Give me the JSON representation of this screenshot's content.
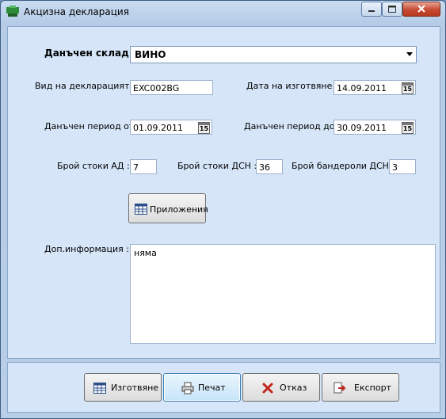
{
  "window": {
    "title": "Акцизна декларация"
  },
  "warehouse": {
    "label": "Данъчен склад :",
    "value": "ВИНО"
  },
  "declaration_type": {
    "label": "Вид на декларацията :",
    "value": "EXC002BG"
  },
  "date_created": {
    "label": "Дата на изготвяне :",
    "value": "14.09.2011"
  },
  "period_from": {
    "label": "Данъчен период от :",
    "value": "01.09.2011"
  },
  "period_to": {
    "label": "Данъчен период до :",
    "value": "30.09.2011"
  },
  "goods_ad": {
    "label": "Брой стоки АД :",
    "value": "7"
  },
  "goods_dsn": {
    "label": "Брой стоки ДСН :",
    "value": "36"
  },
  "banderols_dsn": {
    "label": "Брой бандероли ДСН :",
    "value": "3"
  },
  "attachments_button": {
    "label": "Приложения"
  },
  "additional_info": {
    "label": "Доп.информация :",
    "value": "няма"
  },
  "calendar_icon_text": "15",
  "buttons": {
    "generate": "Изготвяне",
    "print": "Печат",
    "cancel": "Отказ",
    "export": "Експорт"
  }
}
